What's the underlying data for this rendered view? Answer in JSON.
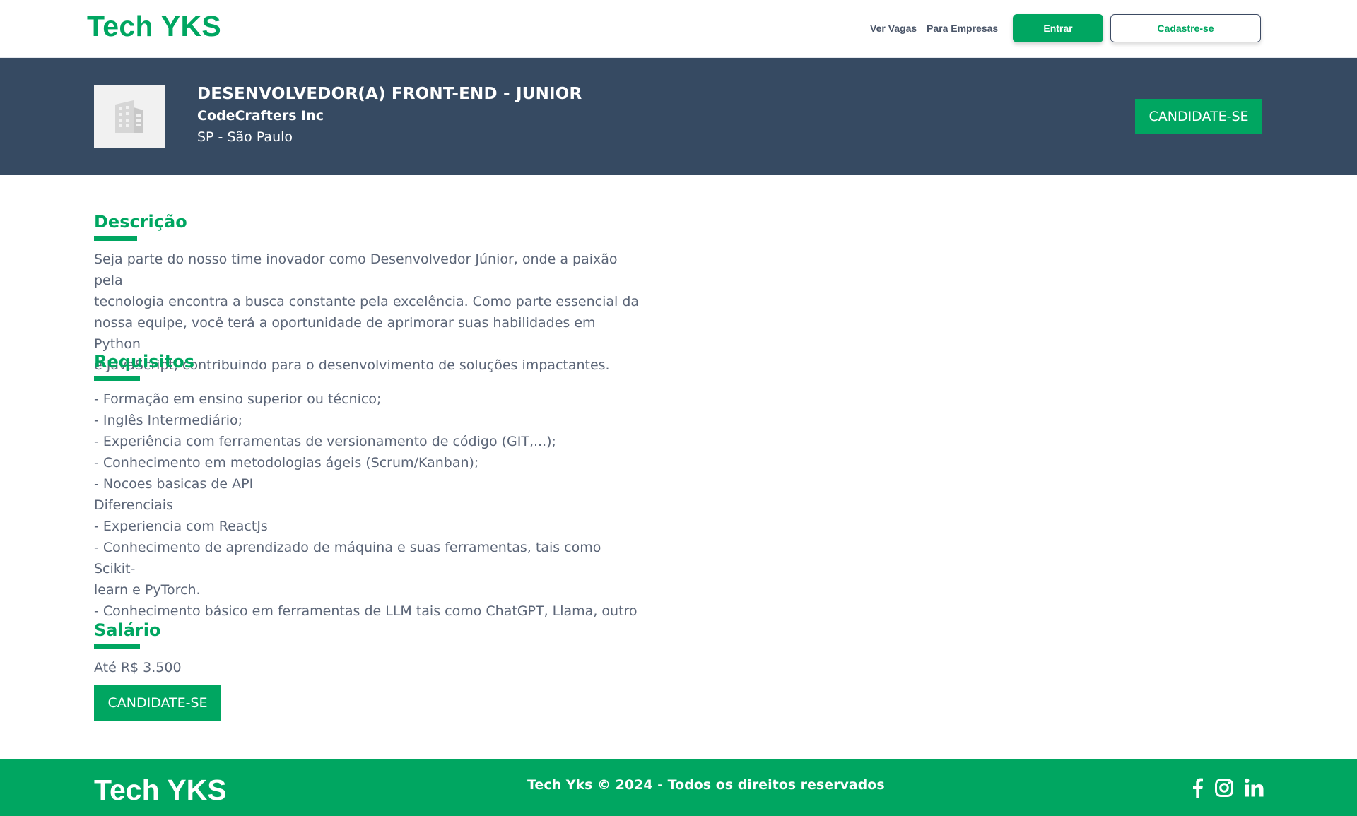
{
  "header": {
    "brand": "Tech YKS",
    "nav": [
      "Ver Vagas",
      "Para Empresas"
    ],
    "login_label": "Entrar",
    "signup_label": "Cadastre-se"
  },
  "job": {
    "title": "DESENVOLVEDOR(A) FRONT-END - JUNIOR",
    "company": "CodeCrafters Inc",
    "location": "SP - São Paulo",
    "apply_label": "CANDIDATE-SE",
    "logo_icon": "building-icon"
  },
  "description": {
    "heading": "Descrição",
    "lines": [
      "Seja parte do nosso time inovador como Desenvolvedor Júnior, onde a paixão pela",
      "tecnologia encontra a busca constante pela excelência. Como parte essencial da",
      "nossa equipe, você terá a oportunidade de aprimorar suas habilidades em Python",
      "e JavaScript, contribuindo para o desenvolvimento de soluções impactantes."
    ]
  },
  "requirements": {
    "heading": "Requisitos",
    "lines": [
      "- Formação em ensino superior ou técnico;",
      "- Inglês Intermediário;",
      "- Experiência com ferramentas de versionamento de código (GIT,...);",
      "- Conhecimento em metodologias ágeis (Scrum/Kanban);",
      "- Nocoes basicas de API",
      "Diferenciais",
      "- Experiencia com ReactJs",
      "- Conhecimento de aprendizado de máquina e suas ferramentas, tais como Scikit-",
      "learn e PyTorch.",
      "- Conhecimento básico em ferramentas de LLM tais como ChatGPT, Llama, outro"
    ]
  },
  "salary": {
    "heading": "Salário",
    "value": "Até R$ 3.500",
    "apply_label": "CANDIDATE-SE"
  },
  "footer": {
    "brand": "Tech YKS",
    "copyright": "Tech Yks © 2024 - Todos os direitos reservados",
    "social": [
      "facebook-icon",
      "instagram-icon",
      "linkedin-icon"
    ]
  },
  "colors": {
    "accent": "#00a661",
    "hero_bg": "#364a62",
    "text": "#5b6577"
  }
}
